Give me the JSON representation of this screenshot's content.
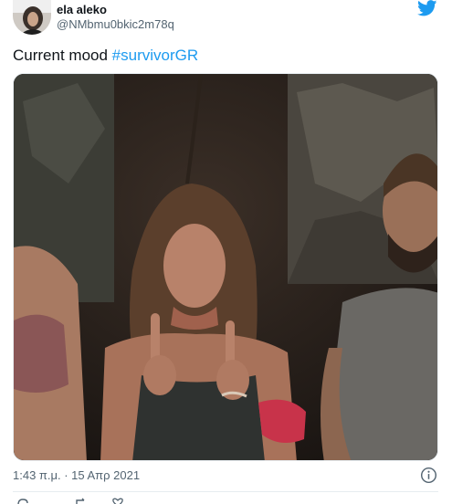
{
  "tweet": {
    "author": {
      "display_name": "ela aleko",
      "handle": "@NMbmu0bkic2m78q"
    },
    "text_prefix": "Current mood ",
    "hashtag": "#survivorGR",
    "timestamp": "1:43 π.μ. · 15 Απρ 2021"
  },
  "icons": {
    "logo": "twitter-bird-icon",
    "info": "info-icon",
    "actions": [
      "reply-icon",
      "retweet-icon",
      "like-icon"
    ]
  },
  "colors": {
    "accent": "#1d9bf0",
    "text": "#0f1419",
    "secondary_text": "#536471",
    "border": "#e6ecf0"
  }
}
